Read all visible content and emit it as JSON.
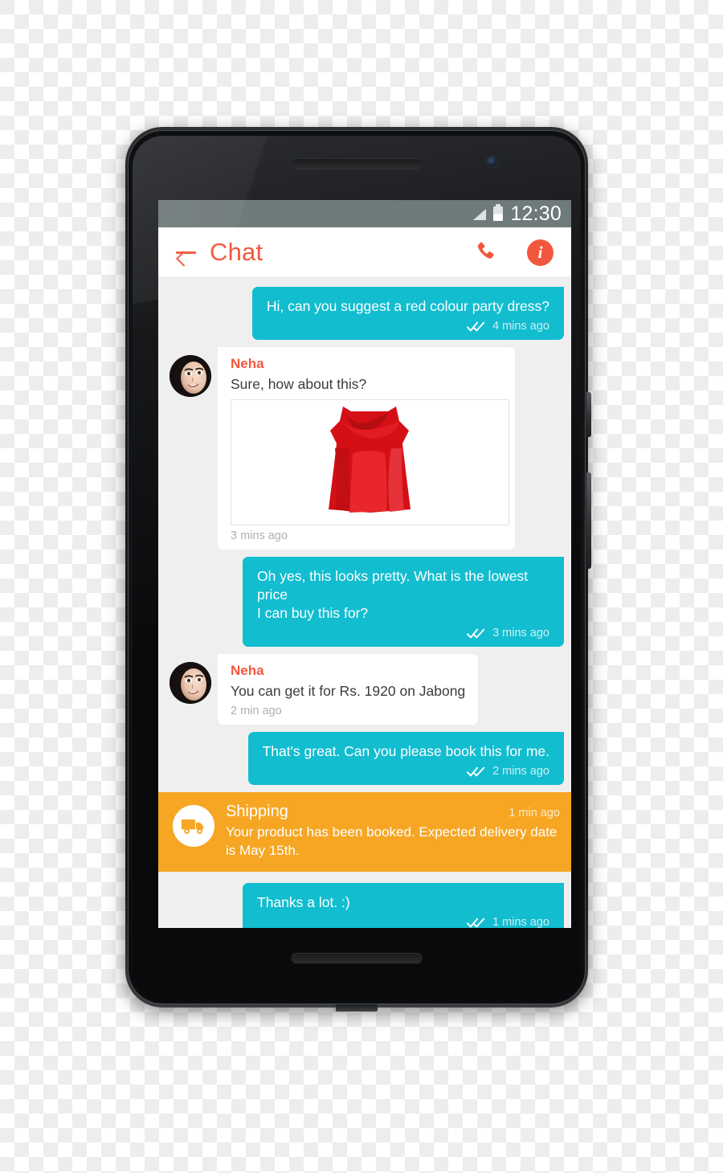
{
  "device": {
    "type": "android-smartphone",
    "elements": [
      "earpiece-speaker",
      "front-camera",
      "power-button",
      "volume-button"
    ]
  },
  "statusbar": {
    "time": "12:30",
    "signal_icon": "signal-bars-icon",
    "battery_icon": "battery-icon",
    "background": "#6f7a7a"
  },
  "appbar": {
    "back_icon": "back-arrow-icon",
    "title": "Chat",
    "call_icon": "phone-call-icon",
    "info_icon": "info-icon",
    "info_glyph": "i",
    "accent": "#f2573d"
  },
  "theme": {
    "outgoing_bubble": "#12bdd0",
    "incoming_bubble": "#ffffff",
    "chat_background": "#efefef",
    "shipping_banner": "#f6a623",
    "sender_name_color": "#f2573d"
  },
  "messages": [
    {
      "id": "msg-1",
      "direction": "out",
      "text": "Hi, can you suggest a red colour party dress?",
      "time": "4 mins ago",
      "status_icon": "double-check-icon"
    },
    {
      "id": "msg-2",
      "direction": "in",
      "sender": "Neha",
      "avatar": "contact-avatar",
      "text": "Sure, how about this?",
      "attachment": "red-party-dress-photo",
      "time": "3 mins ago"
    },
    {
      "id": "msg-3",
      "direction": "out",
      "text": "Oh yes, this looks pretty. What is the lowest price\n I can buy this for?",
      "time": "3 mins ago",
      "status_icon": "double-check-icon"
    },
    {
      "id": "msg-4",
      "direction": "in",
      "sender": "Neha",
      "avatar": "contact-avatar",
      "text": "You can get it for Rs. 1920 on Jabong",
      "time": "2 min ago"
    },
    {
      "id": "msg-5",
      "direction": "out",
      "text": "That's great. Can you please book this for me.",
      "time": "2 mins ago",
      "status_icon": "double-check-icon"
    },
    {
      "id": "msg-6",
      "direction": "banner",
      "icon": "delivery-truck-icon",
      "title": "Shipping",
      "text": "Your product has been booked. Expected delivery date is May 15th.",
      "time": "1 min ago"
    },
    {
      "id": "msg-7",
      "direction": "out",
      "text": "Thanks a lot. :)",
      "time": "1 mins ago",
      "status_icon": "double-check-icon"
    }
  ]
}
